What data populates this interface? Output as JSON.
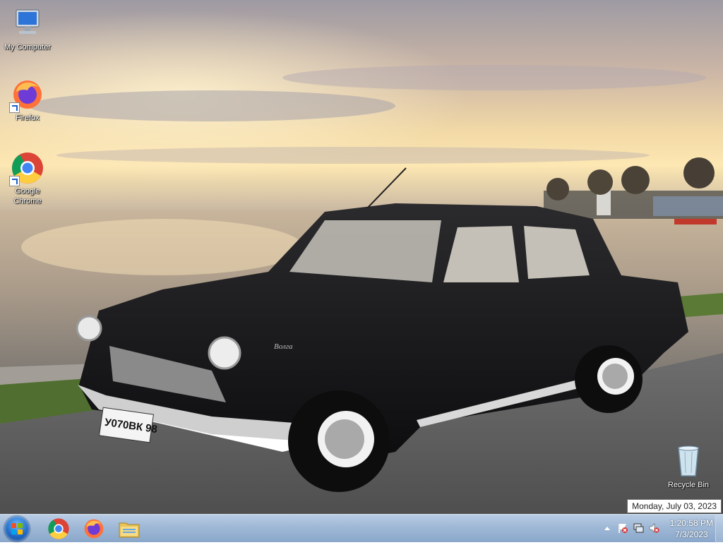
{
  "desktop": {
    "icons": [
      {
        "label": "My Computer"
      },
      {
        "label": "Firefox"
      },
      {
        "label": "Google Chrome"
      },
      {
        "label": "Recycle Bin"
      }
    ],
    "license_plate": "У070ВК 98",
    "badge_script": "Волга"
  },
  "tooltip": {
    "text": "Monday, July 03, 2023"
  },
  "taskbar": {
    "pinned": [
      "chrome-icon",
      "firefox-icon",
      "file-explorer-icon"
    ],
    "clock": {
      "time": "1:20:58 PM",
      "date": "7/3/2023"
    }
  }
}
